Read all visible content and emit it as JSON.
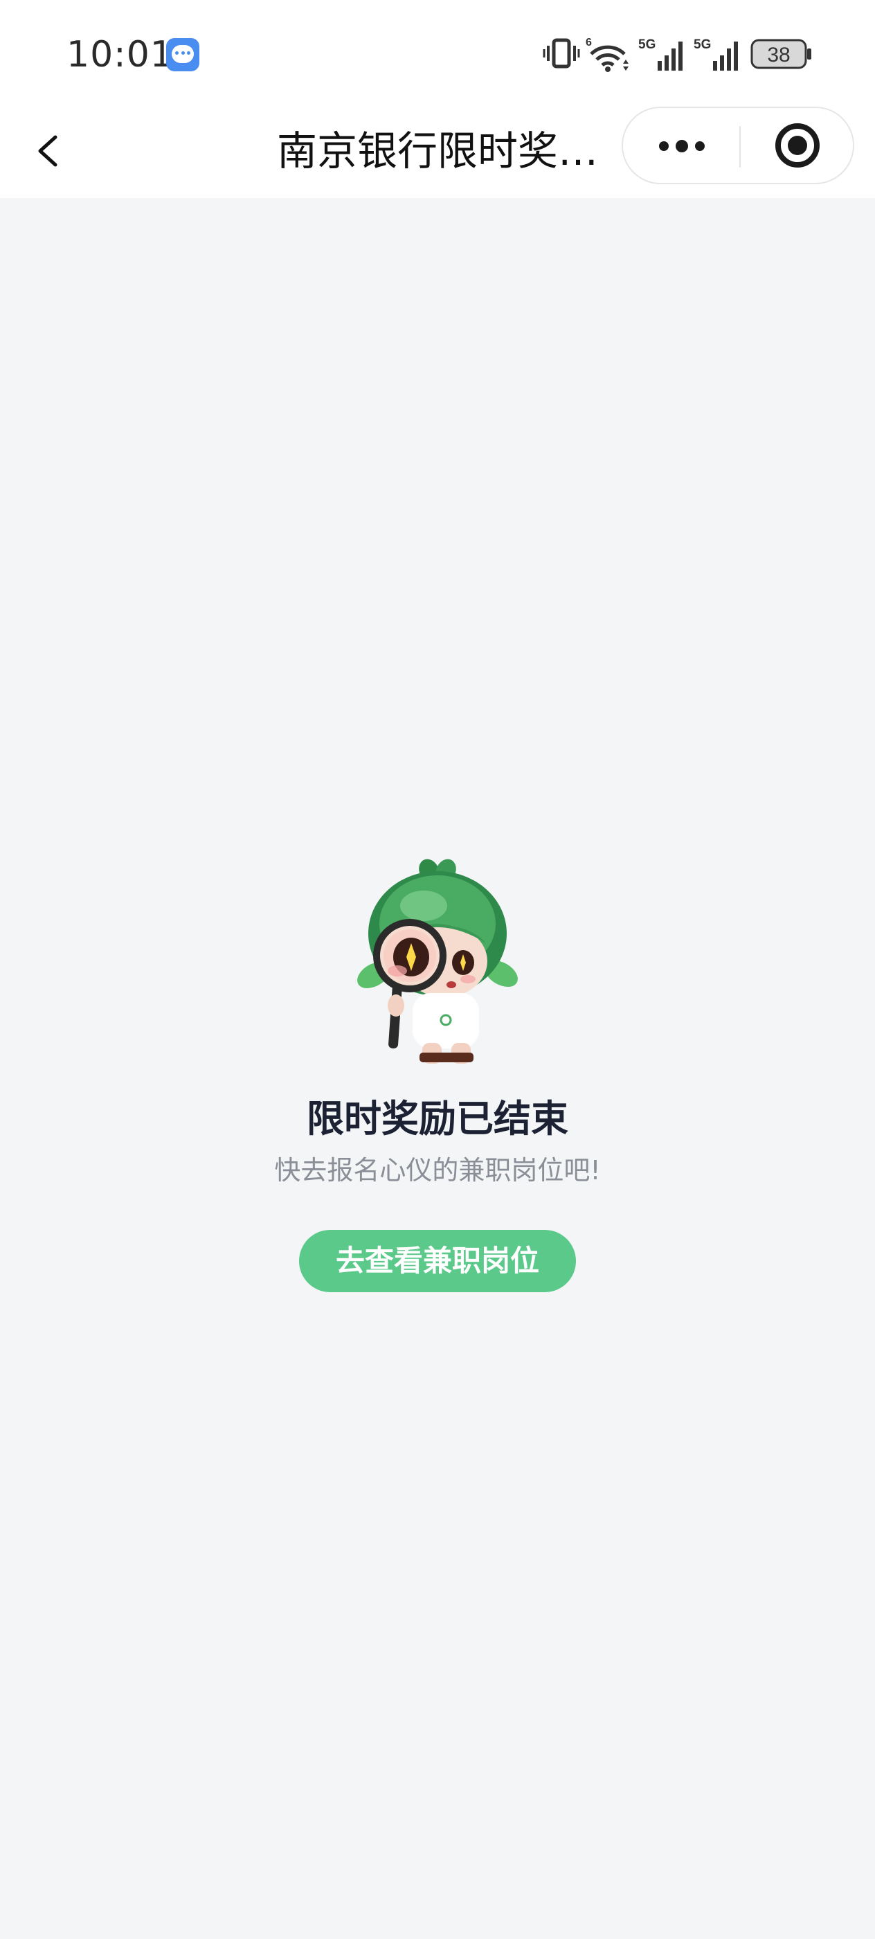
{
  "status_bar": {
    "time": "10:01",
    "battery_level": "38",
    "signal_1_label": "5G",
    "signal_2_label": "5G",
    "wifi_label": "6",
    "icons": [
      "message-app-icon",
      "vibrate-icon",
      "wifi-icon",
      "signal-icon",
      "signal-icon",
      "battery-icon"
    ]
  },
  "nav": {
    "title": "南京银行限时奖…",
    "back_icon": "chevron-left-icon",
    "more_icon": "more-dots-icon",
    "close_icon": "target-close-icon"
  },
  "empty_state": {
    "illustration": "mascot-magnifier-illustration",
    "title": "限时奖励已结束",
    "subtitle": "快去报名心仪的兼职岗位吧!",
    "button_label": "去查看兼职岗位"
  },
  "colors": {
    "background": "#f4f5f7",
    "accent": "#5ac98a",
    "title_text": "#1c2233",
    "subtitle_text": "#8a8e96"
  }
}
